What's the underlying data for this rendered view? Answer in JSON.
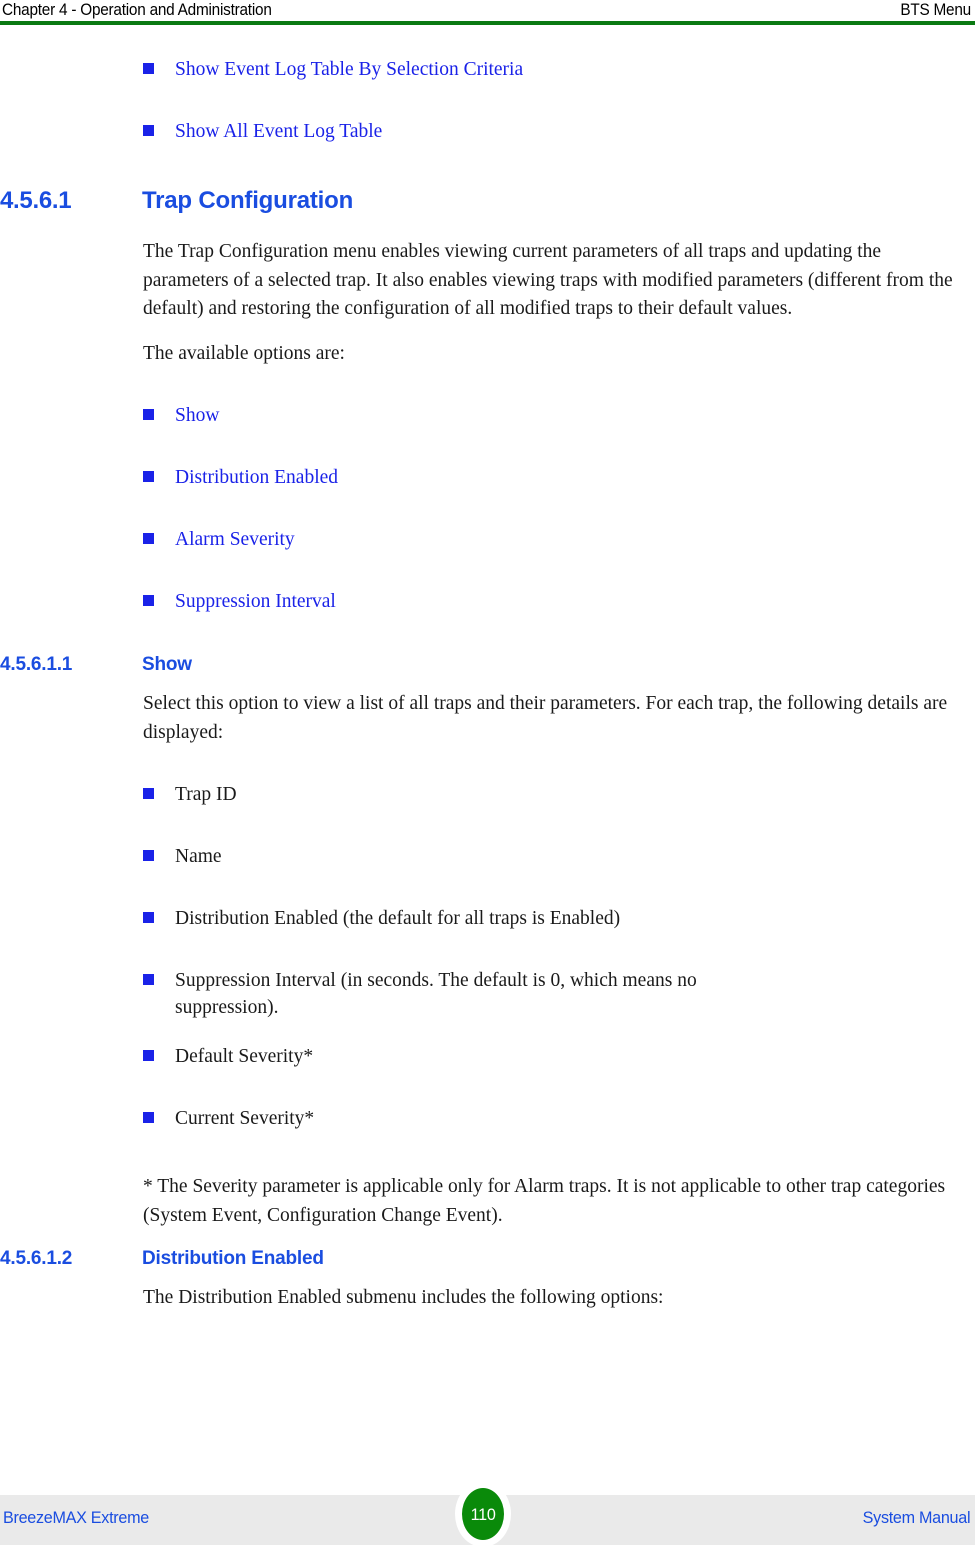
{
  "header": {
    "left": "Chapter 4 - Operation and Administration",
    "right": "BTS Menu",
    "rule_color": "#0a7a12"
  },
  "footer": {
    "left": "BreezeMAX Extreme",
    "right": "System Manual",
    "page_number": "110",
    "badge_color": "#0a8a0a",
    "band_color": "#eaeaea",
    "link_color": "#1a4de0"
  },
  "colors": {
    "link_blue": "#1a22e8",
    "heading_blue": "#1a4de0",
    "body_black": "#1a1a1a",
    "bullet_blue": "#1a22e8"
  },
  "content": {
    "top_links": [
      {
        "label": "Show Event Log Table By Selection Criteria"
      },
      {
        "label": "Show All Event Log Table"
      }
    ],
    "section_1": {
      "number": "4.5.6.1",
      "title": "Trap Configuration",
      "paragraph_1": "The Trap Configuration menu enables viewing current parameters of all traps and updating the parameters of a selected trap. It also enables viewing traps with modified parameters (different from the default) and restoring the configuration of all modified traps to their default values.",
      "paragraph_2": "The available options are:",
      "options": [
        {
          "label": "Show"
        },
        {
          "label": "Distribution Enabled"
        },
        {
          "label": "Alarm Severity"
        },
        {
          "label": "Suppression Interval"
        }
      ]
    },
    "section_2": {
      "number": "4.5.6.1.1",
      "title": "Show",
      "paragraph_1": "Select this option to view a list of all traps and their parameters. For each trap, the following details are displayed:",
      "details": [
        {
          "label": "Trap ID"
        },
        {
          "label": "Name"
        },
        {
          "label": "Distribution Enabled (the default for all traps is Enabled)"
        },
        {
          "label": "Suppression Interval (in seconds. The default is 0, which means no suppression)."
        },
        {
          "label": "Default Severity*"
        },
        {
          "label": "Current Severity*"
        }
      ],
      "footnote": "* The Severity parameter is applicable only for Alarm traps. It is not applicable to other trap categories (System Event, Configuration Change Event)."
    },
    "section_3": {
      "number": "4.5.6.1.2",
      "title": "Distribution Enabled",
      "paragraph_1": "The Distribution Enabled submenu includes the following options:"
    }
  }
}
